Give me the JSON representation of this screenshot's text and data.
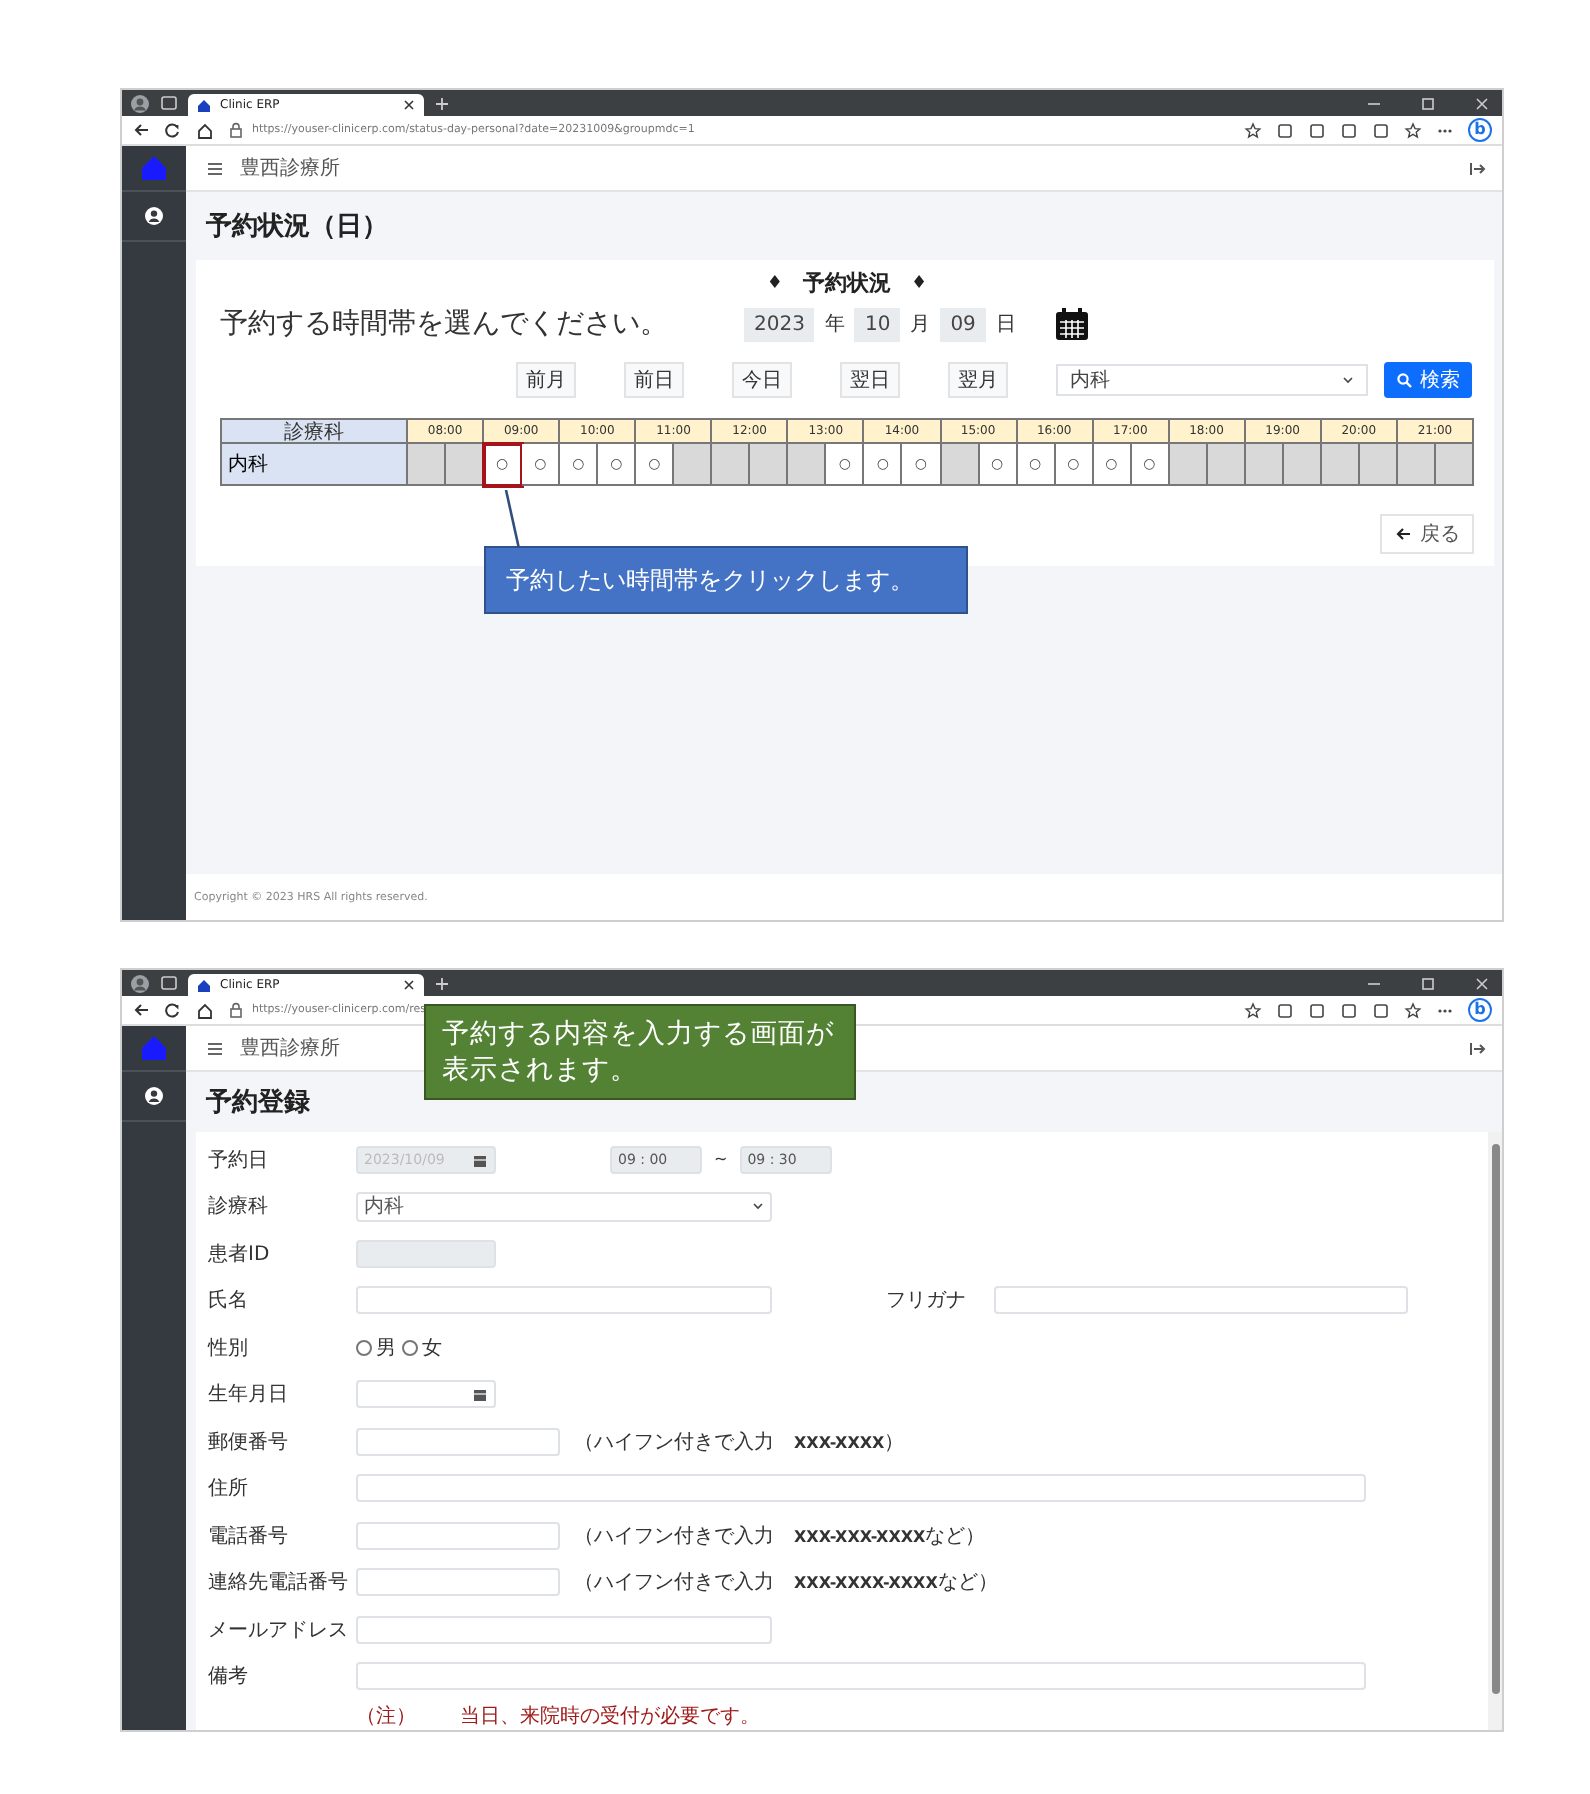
{
  "screens": [
    {
      "kind": "status",
      "browser": {
        "tab_title": "Clinic ERP",
        "url": "https://youser-clinicerp.com/status-day-personal?date=20231009&groupmdc=1",
        "assistant_button": "b"
      },
      "app": {
        "clinic_name": "豊西診療所",
        "page_title": "予約状況（日）",
        "heading_left": "♦",
        "heading": "予約状況",
        "heading_right": "♦",
        "instruction": "予約する時間帯を選んでください。",
        "date": {
          "year": "2023",
          "year_unit": "年",
          "month": "10",
          "month_unit": "月",
          "day": "09",
          "day_unit": "日"
        },
        "nav_buttons": [
          "前月",
          "前日",
          "今日",
          "翌日",
          "翌月"
        ],
        "department_select": "内科",
        "search_button": "検索",
        "table": {
          "header_label": "診療科",
          "hours": [
            "08:00",
            "09:00",
            "10:00",
            "11:00",
            "12:00",
            "13:00",
            "14:00",
            "15:00",
            "16:00",
            "17:00",
            "18:00",
            "19:00",
            "20:00",
            "21:00"
          ],
          "rows": [
            {
              "label": "内科",
              "slots": [
                {
                  "available": false,
                  "selected": false
                },
                {
                  "available": false,
                  "selected": false
                },
                {
                  "available": true,
                  "text": "○",
                  "selected": true
                },
                {
                  "available": true,
                  "text": "○",
                  "selected": false
                },
                {
                  "available": true,
                  "text": "○",
                  "selected": false
                },
                {
                  "available": true,
                  "text": "○",
                  "selected": false
                },
                {
                  "available": true,
                  "text": "○",
                  "selected": false
                },
                {
                  "available": false,
                  "selected": false
                },
                {
                  "available": false,
                  "selected": false
                },
                {
                  "available": false,
                  "selected": false
                },
                {
                  "available": false,
                  "selected": false
                },
                {
                  "available": true,
                  "text": "○",
                  "selected": false
                },
                {
                  "available": true,
                  "text": "○",
                  "selected": false
                },
                {
                  "available": true,
                  "text": "○",
                  "selected": false
                },
                {
                  "available": false,
                  "selected": false
                },
                {
                  "available": true,
                  "text": "○",
                  "selected": false
                },
                {
                  "available": true,
                  "text": "○",
                  "selected": false
                },
                {
                  "available": true,
                  "text": "○",
                  "selected": false
                },
                {
                  "available": true,
                  "text": "○",
                  "selected": false
                },
                {
                  "available": true,
                  "text": "○",
                  "selected": false
                },
                {
                  "available": false,
                  "selected": false
                },
                {
                  "available": false,
                  "selected": false
                },
                {
                  "available": false,
                  "selected": false
                },
                {
                  "available": false,
                  "selected": false
                },
                {
                  "available": false,
                  "selected": false
                },
                {
                  "available": false,
                  "selected": false
                },
                {
                  "available": false,
                  "selected": false
                },
                {
                  "available": false,
                  "selected": false
                }
              ]
            }
          ]
        },
        "back_button": "戻る",
        "footer": "Copyright © 2023 HRS All rights reserved."
      },
      "callout": {
        "text": "予約したい時間帯をクリックします。",
        "color": "#4472c4"
      }
    },
    {
      "kind": "form",
      "browser": {
        "tab_title": "Clinic ERP",
        "url": "https://youser-clinicerp.com/res",
        "assistant_button": "b"
      },
      "app": {
        "clinic_name": "豊西診療所",
        "page_title": "予約登録",
        "rows": [
          {
            "kind": "date_range",
            "label": "予約日",
            "date": "2023/10/09",
            "start": "09 : 00",
            "separator": "~",
            "end": "09 : 30"
          },
          {
            "kind": "select",
            "label": "診療科",
            "value": "内科"
          },
          {
            "kind": "readonly",
            "label": "患者ID"
          },
          {
            "kind": "pair",
            "label": "氏名",
            "second_label": "フリガナ"
          },
          {
            "kind": "radio",
            "label": "性別",
            "options": [
              {
                "label": "男",
                "selected": false
              },
              {
                "label": "女",
                "selected": false
              }
            ]
          },
          {
            "kind": "date",
            "label": "生年月日"
          },
          {
            "kind": "hint",
            "label": "郵便番号",
            "hint": "（ハイフン付きで入力　**XXX-XXXX**）"
          },
          {
            "kind": "wide",
            "label": "住所"
          },
          {
            "kind": "hint",
            "label": "電話番号",
            "hint": "（ハイフン付きで入力　**XXX-XXX-XXXX**など）"
          },
          {
            "kind": "hint",
            "label": "連絡先電話番号",
            "hint": "（ハイフン付きで入力　**XXX-XXXX-XXXX**など）"
          },
          {
            "kind": "medium",
            "label": "メールアドレス"
          },
          {
            "kind": "wide",
            "label": "備考"
          }
        ],
        "note": {
          "mark": "（注）",
          "text": "当日、来院時の受付が必要です。"
        }
      },
      "callout": {
        "text": "予約する内容を入力する画面が表示されます。",
        "color": "#548235"
      }
    }
  ]
}
